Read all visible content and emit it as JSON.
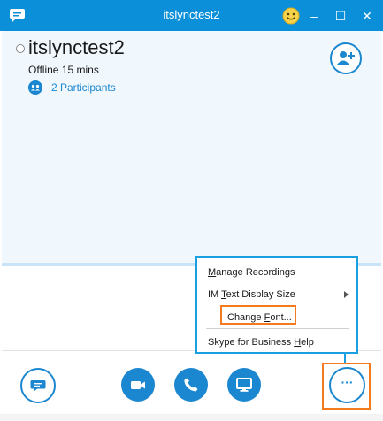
{
  "window": {
    "title": "itslynctest2",
    "minimize_glyph": "–",
    "maximize_glyph": "☐",
    "close_glyph": "✕"
  },
  "conversation": {
    "name": "itslynctest2",
    "status": "Offline 15 mins",
    "participants_label": "2 Participants"
  },
  "menu": {
    "items": [
      {
        "pre": "",
        "acc": "M",
        "post": "anage Recordings"
      },
      {
        "pre": "IM ",
        "acc": "T",
        "post": "ext Display Size"
      },
      {
        "pre": "Change ",
        "acc": "F",
        "post": "ont..."
      },
      {
        "pre": "Skype for Business ",
        "acc": "H",
        "post": "elp"
      }
    ]
  },
  "toolbar": {
    "more_label": "···"
  },
  "colors": {
    "titlebar": "#0b8fd8",
    "accent": "#1a87d0",
    "highlight": "#f47a20",
    "menu_border": "#1a9fe0"
  },
  "icons": [
    "chat-bubble-icon",
    "smiley-icon",
    "add-person-icon",
    "participants-icon",
    "im-icon",
    "video-icon",
    "phone-icon",
    "present-screen-icon",
    "more-options-icon",
    "submenu-arrow-icon"
  ]
}
